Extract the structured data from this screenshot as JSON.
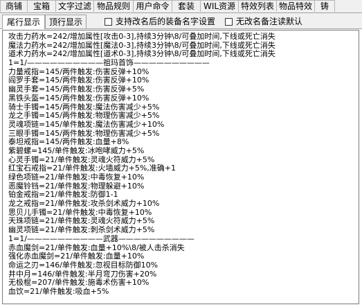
{
  "top_tabs": [
    "商铺",
    "宝箱",
    "文字过滤",
    "物品规则",
    "用户命令",
    "套装",
    "WIL资源",
    "特效列表",
    "物品特效",
    "铸"
  ],
  "sub_tabs": {
    "tail_display": "尾行显示",
    "head_display": "顶行显示"
  },
  "options": {
    "rename_setting": "支持改名后的装备名字设置",
    "no_rename_note": "无改名备注读默认"
  },
  "lines": [
    "攻击力药水=242/增加属性[攻击0-3],持续3分钟\\8/可叠加时间,下线或死亡消失",
    "魔法力药水=242/增加属性[魔法0-3],持续3分钟\\8/可叠加时间,下线或死亡消失",
    "道术力药水=242/增加属性[道术0-3],持续3分钟\\8/可叠加时间,下线或死亡消失",
    "1=1/——————————祖玛首饰——————————",
    "力量戒指=145/两件触发:伤害反弹+10%",
    "阎罗手套=145/两件触发:伤害反弹+10%",
    "幽灵手套=145/两件触发:伤害反弹+5%",
    "黑铁头盔=145/两件触发:伤害反弹+10%",
    "骑士手镯=145/两件触发:魔法伤害减少+5%",
    "龙之手镯=145/两件触发:物理伤害减少+5%",
    "灵魂项链=145/单件触发:魔法伤害减少+10%",
    "三眼手镯=145/两件触发:物理伤害减少+5%",
    "泰坦戒指=145/两件触发:血量+8%",
    "紫碧螺=145/单件触发:冰咆哮威力+5%",
    "心灵手镯=21/单件触发:灵魂火符威力+5%",
    "红宝石戒指=21/单件触发:火墙威力+5%,准确+1",
    "绿色项链=21/单件触发:中毒恢复+10%",
    "恶魔铃铛=21/单件触发:物理躲避+10%",
    "铂金戒指=21/单件触发:防御1-1",
    "龙之戒指=21/单件触发:攻杀剑术威力+10%",
    "思贝儿手镯=21/单件触发:中毒恢复+10%",
    "天珠项链=21/单件触发:灵魂火符威力+5%",
    "幽灵项链=21/单件触发:刺杀剑术威力+5%",
    "1=1/——————————武器——————————",
    "赤血魔剑=21/单件触发:血量+10%\\8/被人击杀消失",
    "强化赤血魔剑=21/单件触发:血量+10%",
    "命运之刃=146/单件触发:忽视目标防御10%",
    "井中月=146/单件触发:半月弯刀伤害+20%",
    "无极棍=207/单件触发:施毒术伤害+10%",
    "血饮=21/单件触发:吸血+5%"
  ]
}
